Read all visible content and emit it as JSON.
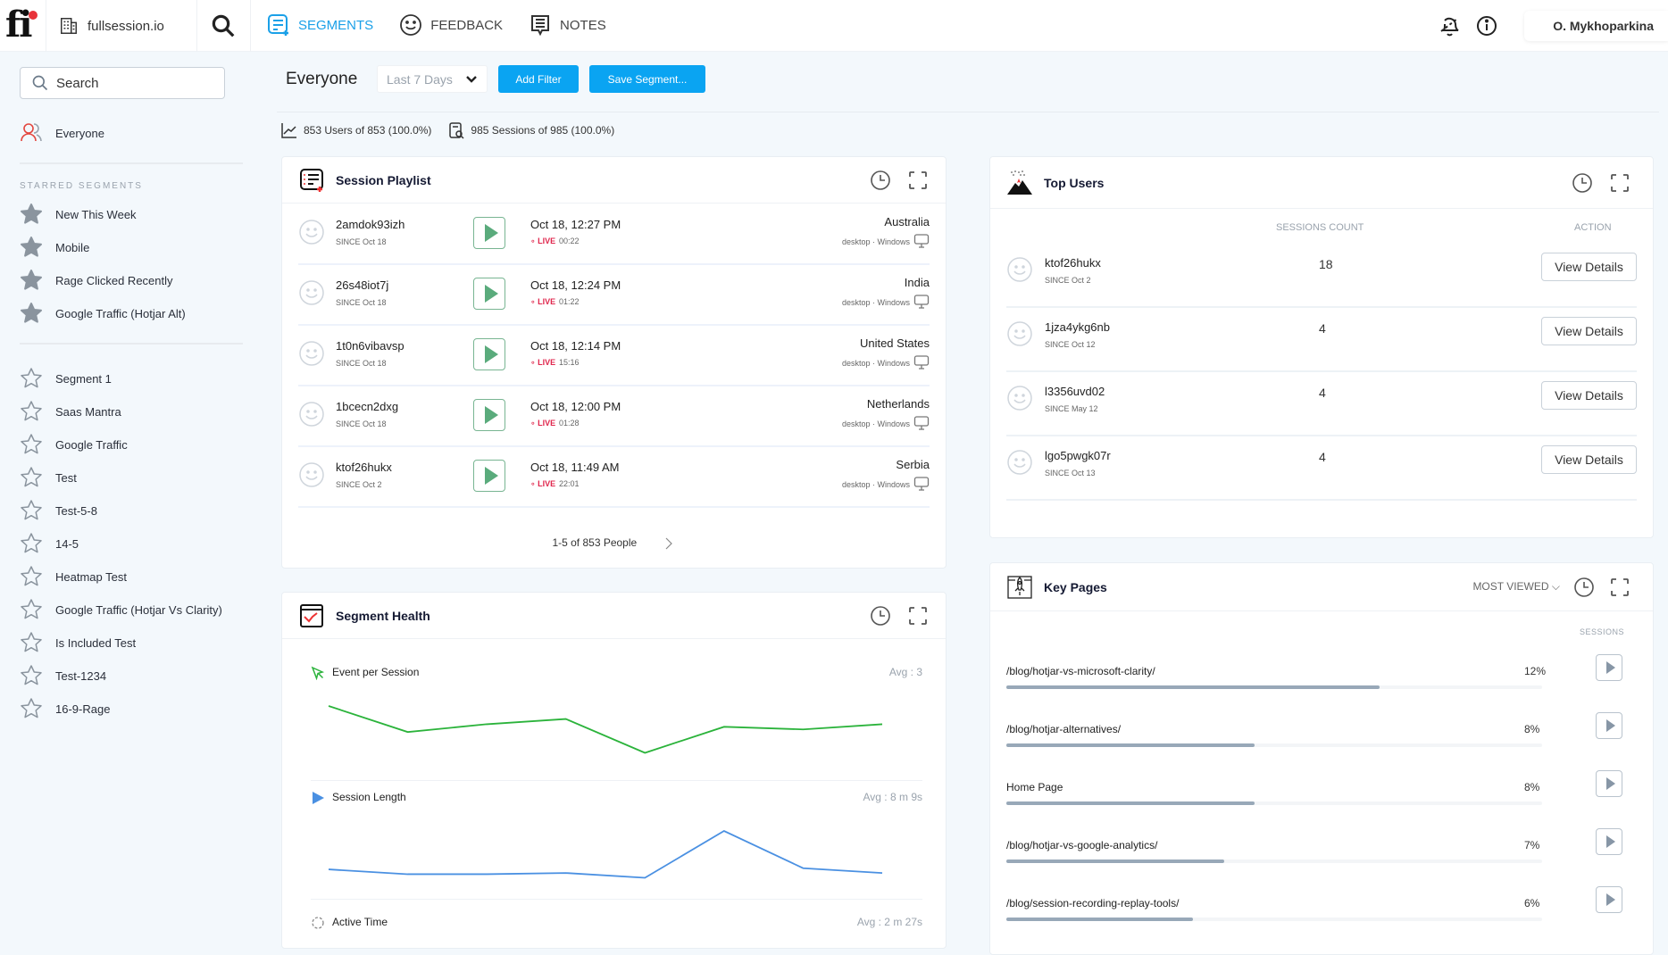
{
  "topbar": {
    "logo": "fi",
    "org_name": "fullsession.io",
    "nav": [
      {
        "label": "SEGMENTS",
        "icon": "segments-icon",
        "active": true
      },
      {
        "label": "FEEDBACK",
        "icon": "smiley-icon",
        "active": false
      },
      {
        "label": "NOTES",
        "icon": "notes-icon",
        "active": false
      }
    ],
    "user_name": "O. Mykhoparkina"
  },
  "sidebar": {
    "search_placeholder": "Search",
    "everyone_label": "Everyone",
    "starred_heading": "STARRED SEGMENTS",
    "starred": [
      "New This Week",
      "Mobile",
      "Rage Clicked Recently",
      "Google Traffic (Hotjar Alt)"
    ],
    "segments": [
      "Segment 1",
      "Saas Mantra",
      "Google Traffic",
      "Test",
      "Test-5-8",
      "14-5",
      "Heatmap Test",
      "Google Traffic (Hotjar Vs Clarity)",
      "Is Included Test",
      "Test-1234",
      "16-9-Rage"
    ]
  },
  "header": {
    "segment_title": "Everyone",
    "date_range": "Last 7 Days",
    "add_filter_label": "Add Filter",
    "save_segment_label": "Save Segment...",
    "users_stat": "853 Users of 853 (100.0%)",
    "sessions_stat": "985 Sessions of 985 (100.0%)"
  },
  "session_playlist": {
    "title": "Session Playlist",
    "rows": [
      {
        "user": "2amdok93izh",
        "since": "SINCE Oct 18",
        "date": "Oct 18, 12:27 PM",
        "live": "LIVE",
        "duration": "00:22",
        "country": "Australia",
        "device": "desktop · Windows"
      },
      {
        "user": "26s48iot7j",
        "since": "SINCE Oct 18",
        "date": "Oct 18, 12:24 PM",
        "live": "LIVE",
        "duration": "01:22",
        "country": "India",
        "device": "desktop · Windows"
      },
      {
        "user": "1t0n6vibavsp",
        "since": "SINCE Oct 18",
        "date": "Oct 18, 12:14 PM",
        "live": "LIVE",
        "duration": "15:16",
        "country": "United States",
        "device": "desktop · Windows"
      },
      {
        "user": "1bcecn2dxg",
        "since": "SINCE Oct 18",
        "date": "Oct 18, 12:00 PM",
        "live": "LIVE",
        "duration": "01:28",
        "country": "Netherlands",
        "device": "desktop · Windows"
      },
      {
        "user": "ktof26hukx",
        "since": "SINCE Oct 2",
        "date": "Oct 18, 11:49 AM",
        "live": "LIVE",
        "duration": "22:01",
        "country": "Serbia",
        "device": "desktop · Windows"
      }
    ],
    "pager": "1-5 of 853 People"
  },
  "top_users": {
    "title": "Top Users",
    "col_sessions": "SESSIONS COUNT",
    "col_action": "ACTION",
    "action_label": "View Details",
    "rows": [
      {
        "user": "ktof26hukx",
        "since": "SINCE Oct 2",
        "count": "18"
      },
      {
        "user": "1jza4ykg6nb",
        "since": "SINCE Oct 12",
        "count": "4"
      },
      {
        "user": "l3356uvd02",
        "since": "SINCE May 12",
        "count": "4"
      },
      {
        "user": "lgo5pwgk07r",
        "since": "SINCE Oct 13",
        "count": "4"
      }
    ]
  },
  "key_pages": {
    "title": "Key Pages",
    "sort_label": "MOST VIEWED",
    "col_sessions": "SESSIONS",
    "rows": [
      {
        "page": "/blog/hotjar-vs-microsoft-clarity/",
        "pct": "12%",
        "value": 12
      },
      {
        "page": "/blog/hotjar-alternatives/",
        "pct": "8%",
        "value": 8
      },
      {
        "page": "Home Page",
        "pct": "8%",
        "value": 8
      },
      {
        "page": "/blog/hotjar-vs-google-analytics/",
        "pct": "7%",
        "value": 7
      },
      {
        "page": "/blog/session-recording-replay-tools/",
        "pct": "6%",
        "value": 6
      }
    ]
  },
  "segment_health": {
    "title": "Segment Health",
    "metrics": [
      {
        "label": "Event per Session",
        "avg": "Avg : 3",
        "color": "#2bb33b",
        "values": [
          3.4,
          2.9,
          3.05,
          3.15,
          2.5,
          3.0,
          2.95,
          3.05
        ]
      },
      {
        "label": "Session Length",
        "avg": "Avg : 8 m 9s",
        "color": "#4a90e2",
        "values": [
          7.6,
          7.2,
          7.2,
          7.3,
          6.9,
          10.8,
          7.7,
          7.3
        ]
      },
      {
        "label": "Active Time",
        "avg": "Avg : 2 m 27s",
        "color": "#888888",
        "values": []
      }
    ]
  }
}
